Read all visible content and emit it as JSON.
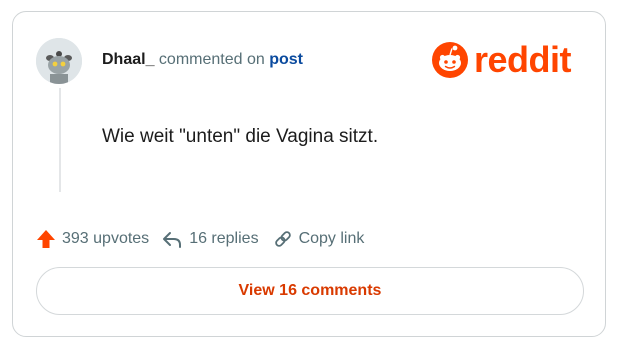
{
  "comment": {
    "author": "Dhaal_",
    "commented_on_text": "commented on",
    "post_link_text": "post",
    "body": "Wie weit \"unten\" die Vagina sitzt."
  },
  "brand": {
    "logo_text": "reddit",
    "logo_icon": "reddit-snoo-icon",
    "color": "#ff4500"
  },
  "actions": {
    "upvotes": "393 upvotes",
    "replies": "16 replies",
    "copy_link": "Copy link"
  },
  "footer": {
    "view_comments_label": "View 16 comments"
  },
  "colors": {
    "upvote_icon": "#ff4500",
    "view_button_text": "#d93a00",
    "post_link": "#0a4a9e"
  }
}
